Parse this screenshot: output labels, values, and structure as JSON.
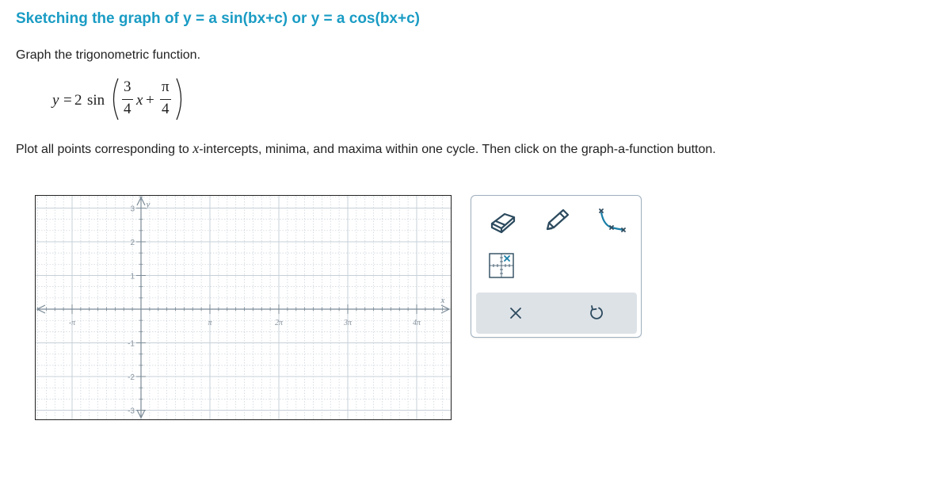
{
  "header": {
    "title": "Sketching the graph of y = a sin(bx+c) or y = a cos(bx+c)"
  },
  "problem": {
    "instruction": "Graph the trigonometric function.",
    "equation": {
      "lhs": "y",
      "equals": "=",
      "amplitude": "2",
      "func": "sin",
      "open_paren": "(",
      "b_num": "3",
      "b_den": "4",
      "var": "x",
      "plus": "+",
      "c_num": "π",
      "c_den": "4",
      "close_paren": ")"
    },
    "plot_instruction_pre": "Plot all points corresponding to ",
    "plot_instruction_var": "x",
    "plot_instruction_post": "-intercepts, minima, and maxima within one cycle. Then click on the graph-a-function button."
  },
  "graph": {
    "x_axis_label": "x",
    "y_axis_label": "y",
    "x_tick_labels": [
      "-π",
      "π",
      "2π",
      "3π",
      "4π"
    ],
    "y_tick_labels": [
      "3",
      "2",
      "1",
      "-1",
      "-2",
      "-3"
    ],
    "grid_color": "#c7d0d8",
    "axis_color": "#7a8a96"
  },
  "toolbox": {
    "tools": [
      {
        "name": "eraser-icon"
      },
      {
        "name": "pencil-icon"
      },
      {
        "name": "graph-function-icon"
      },
      {
        "name": "plot-points-icon"
      }
    ],
    "actions": [
      {
        "name": "clear-icon"
      },
      {
        "name": "undo-icon"
      }
    ],
    "icon_color": "#2c4a5e",
    "accent_color": "#1a7fa8",
    "action_bar_color": "#dde2e7"
  }
}
